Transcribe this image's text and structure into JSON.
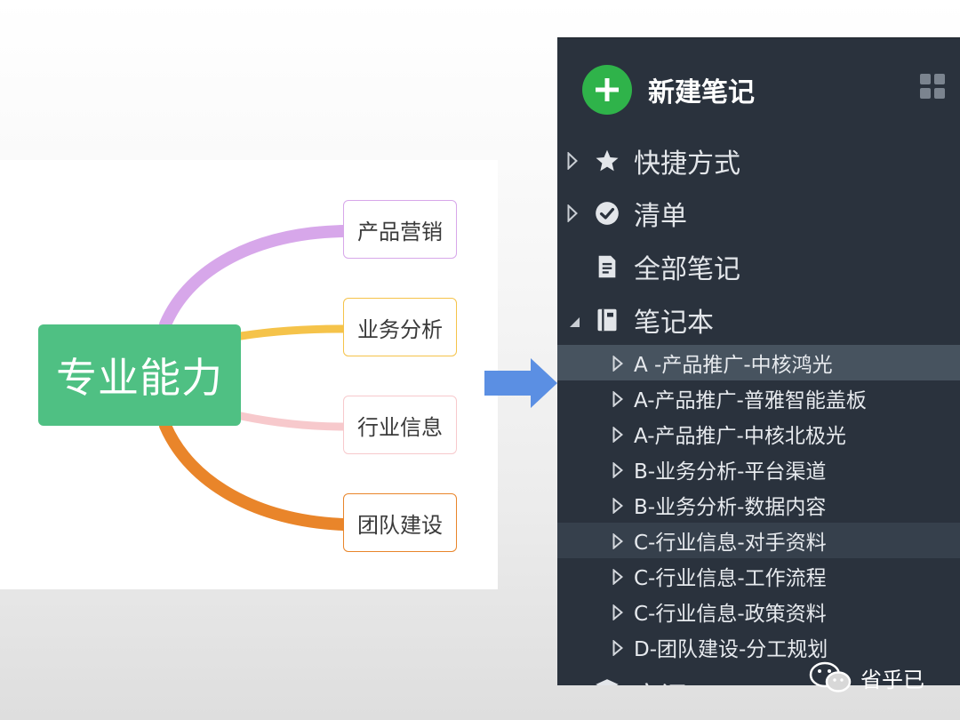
{
  "mindmap": {
    "root": "专业能力",
    "children": [
      {
        "label": "产品营销",
        "color": "#d7a7ea"
      },
      {
        "label": "业务分析",
        "color": "#f5c34a"
      },
      {
        "label": "行业信息",
        "color": "#f7c9cc"
      },
      {
        "label": "团队建设",
        "color": "#e9852a"
      }
    ],
    "root_color": "#4fc083"
  },
  "flow_arrow": {
    "icon": "arrow-right-icon",
    "color": "#5b8fe3"
  },
  "sidebar": {
    "new_note_label": "新建笔记",
    "nav": [
      {
        "label": "快捷方式",
        "icon": "star-icon",
        "expander": "collapsed"
      },
      {
        "label": "清单",
        "icon": "checklist-icon",
        "expander": "collapsed"
      },
      {
        "label": "全部笔记",
        "icon": "notes-icon",
        "expander": "none"
      },
      {
        "label": "笔记本",
        "icon": "notebook-icon",
        "expander": "expanded"
      }
    ],
    "notebooks": [
      "A -产品推广-中核鸿光",
      "A-产品推广-普雅智能盖板",
      "A-产品推广-中核北极光",
      "B-业务分析-平台渠道",
      "B-业务分析-数据内容",
      "C-行业信息-对手资料",
      "C-行业信息-工作流程",
      "C-行业信息-政策资料",
      "D-团队建设-分工规划"
    ],
    "partial_item": "空间",
    "colors": {
      "background": "#2a323d",
      "selected": "#47535f",
      "hover": "#36404c",
      "accent": "#2fb34a"
    }
  },
  "watermark": {
    "text": "省乎已",
    "icon": "wechat-icon"
  }
}
